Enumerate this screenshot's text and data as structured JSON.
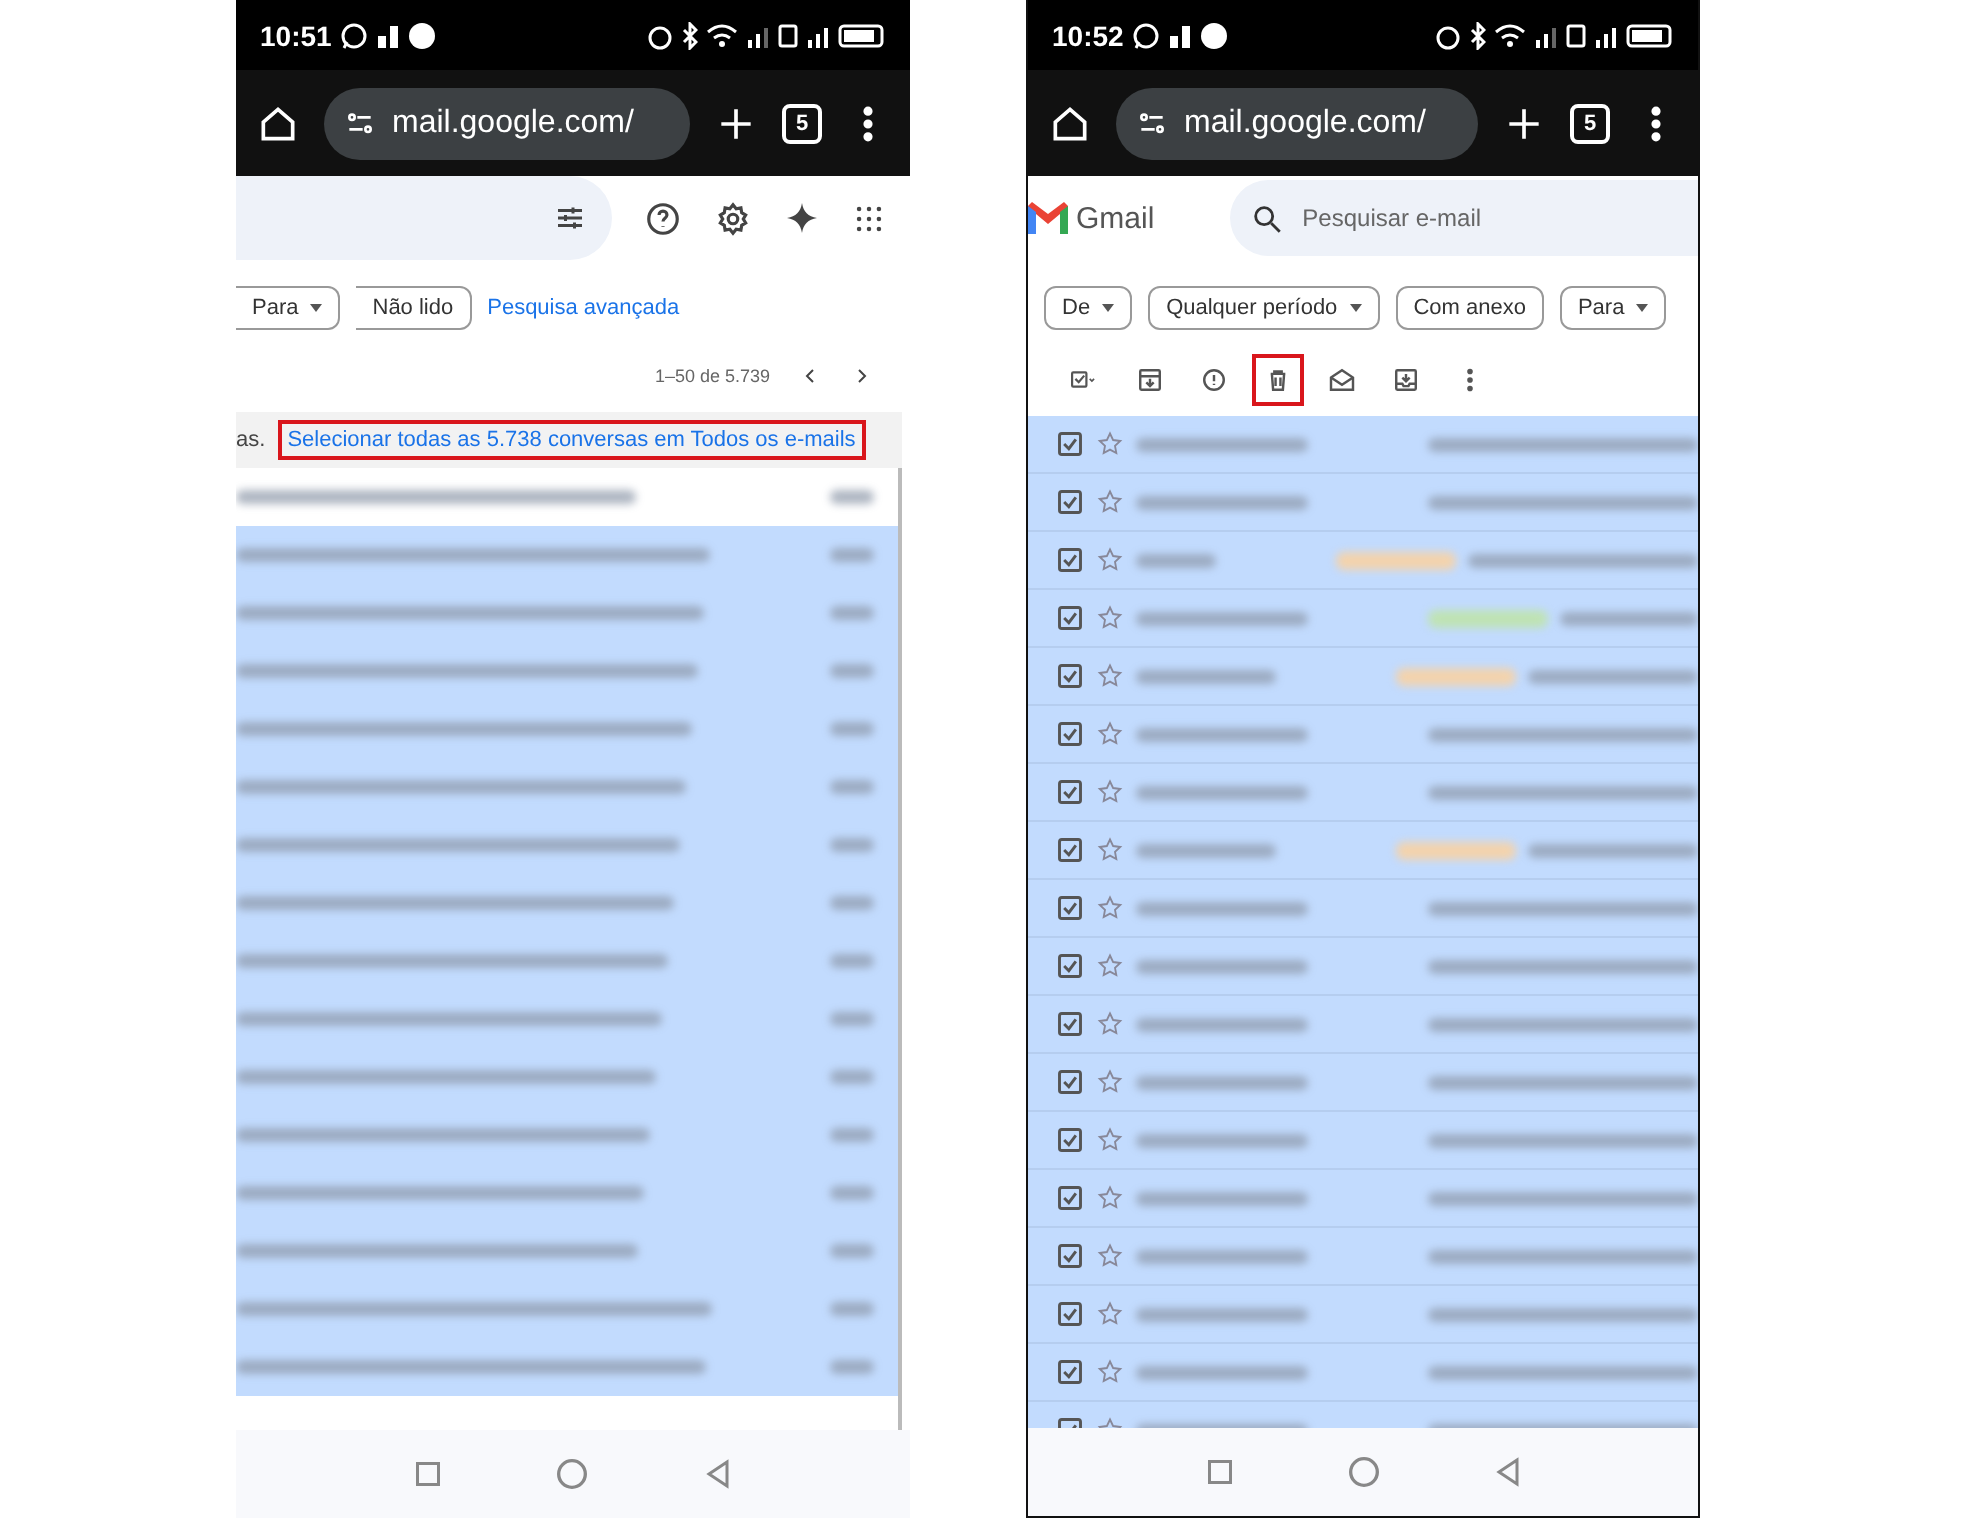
{
  "left_screen": {
    "status_time": "10:51",
    "url": "mail.google.com/",
    "tab_count": "5",
    "filters": [
      {
        "label": "Para",
        "dropdown": true
      },
      {
        "label": "Não lido",
        "dropdown": false
      }
    ],
    "advanced_search": "Pesquisa avançada",
    "pagination": "1–50 de 5.739",
    "banner": {
      "prefix": "as.",
      "link": "Selecionar todas as 5.738 conversas em Todos os e-mails",
      "highlighted": true
    },
    "rows": [
      {
        "selected": false
      },
      {
        "selected": true
      },
      {
        "selected": true
      },
      {
        "selected": true
      },
      {
        "selected": true
      },
      {
        "selected": true
      },
      {
        "selected": true
      },
      {
        "selected": true
      },
      {
        "selected": true
      },
      {
        "selected": true
      },
      {
        "selected": true
      },
      {
        "selected": true
      },
      {
        "selected": true
      },
      {
        "selected": true
      },
      {
        "selected": true
      },
      {
        "selected": true
      }
    ]
  },
  "right_screen": {
    "status_time": "10:52",
    "url": "mail.google.com/",
    "tab_count": "5",
    "app_name": "Gmail",
    "search": {
      "placeholder": "Pesquisar e-mail"
    },
    "filters": [
      {
        "label": "De",
        "dropdown": true
      },
      {
        "label": "Qualquer período",
        "dropdown": true
      },
      {
        "label": "Com anexo",
        "dropdown": false
      },
      {
        "label": "Para",
        "dropdown": true
      }
    ],
    "toolbar": [
      {
        "kind": "select",
        "highlighted": false
      },
      {
        "kind": "archive",
        "highlighted": false
      },
      {
        "kind": "spam",
        "highlighted": false
      },
      {
        "kind": "delete",
        "highlighted": true
      },
      {
        "kind": "read",
        "highlighted": false
      },
      {
        "kind": "move",
        "highlighted": false
      },
      {
        "kind": "more",
        "highlighted": false
      }
    ],
    "rows": [
      {
        "checked": true
      },
      {
        "checked": true
      },
      {
        "checked": true,
        "color": "#f3d3ad"
      },
      {
        "checked": true,
        "color": "#bfe3b4"
      },
      {
        "checked": true,
        "color": "#f3d3ad"
      },
      {
        "checked": true
      },
      {
        "checked": true
      },
      {
        "checked": true,
        "color": "#f3d3ad"
      },
      {
        "checked": true
      },
      {
        "checked": true
      },
      {
        "checked": true
      },
      {
        "checked": true
      },
      {
        "checked": true
      },
      {
        "checked": true
      },
      {
        "checked": true
      },
      {
        "checked": true
      },
      {
        "checked": true
      },
      {
        "checked": true
      }
    ]
  }
}
